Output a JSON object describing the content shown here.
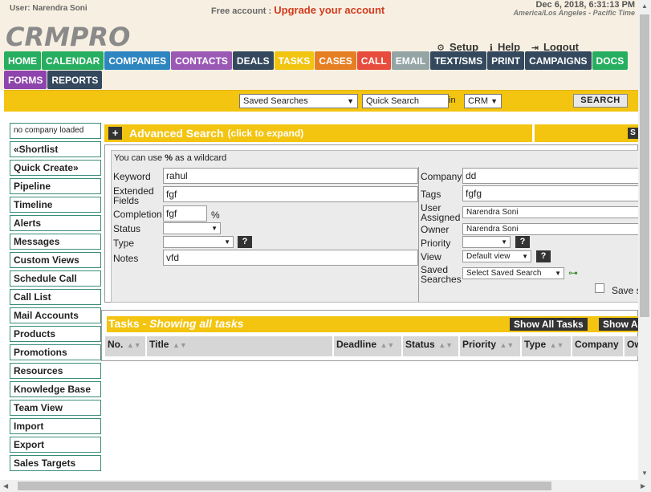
{
  "header": {
    "user": "User: Narendra Soni",
    "free_account": "Free account : ",
    "upgrade_link": "Upgrade your account",
    "datetime": "Dec 6, 2018, 6:31:13 PM",
    "timezone": "America/Los Angeles - Pacific Time",
    "logo": "CRMPRO",
    "setup": "Setup",
    "help": "Help",
    "logout": "Logout"
  },
  "nav": {
    "row1": [
      {
        "label": "HOME",
        "color": "#27ae60"
      },
      {
        "label": "CALENDAR",
        "color": "#27ae60"
      },
      {
        "label": "COMPANIES",
        "color": "#2e86c1"
      },
      {
        "label": "CONTACTS",
        "color": "#9b59b6"
      },
      {
        "label": "DEALS",
        "color": "#34495e"
      },
      {
        "label": "TASKS",
        "color": "#f1c40f"
      },
      {
        "label": "CASES",
        "color": "#e67e22"
      },
      {
        "label": "CALL",
        "color": "#e74c3c"
      },
      {
        "label": "EMAIL",
        "color": "#95a5a6"
      },
      {
        "label": "TEXT/SMS",
        "color": "#34495e"
      },
      {
        "label": "PRINT",
        "color": "#34495e"
      },
      {
        "label": "CAMPAIGNS",
        "color": "#34495e"
      },
      {
        "label": "DOCS",
        "color": "#27ae60"
      }
    ],
    "row2": [
      {
        "label": "FORMS",
        "color": "#8e44ad"
      },
      {
        "label": "REPORTS",
        "color": "#34495e"
      }
    ]
  },
  "searchbar": {
    "saved_searches": "Saved Searches",
    "quick_search": "Quick Search",
    "in_label": "in",
    "scope": "CRM",
    "search_button": "SEARCH"
  },
  "sidebar": {
    "company": "no company loaded",
    "items": [
      "«Shortlist",
      "Quick Create»",
      "Pipeline",
      "Timeline",
      "Alerts",
      "Messages",
      "Custom Views",
      "Schedule Call",
      "Call List",
      "Mail Accounts",
      "Products",
      "Promotions",
      "Resources",
      "Knowledge Base",
      "Team View",
      "Import",
      "Export",
      "Sales Targets"
    ]
  },
  "advanced": {
    "plus": "+",
    "title": "Advanced Search",
    "subtitle": "(click to expand)",
    "save_s": "S",
    "wildcard_pre": "You can use ",
    "wildcard_sym": "%",
    "wildcard_post": " as a wildcard",
    "keyword_label": "Keyword",
    "keyword_value": "rahul",
    "ext_label1": "Extended",
    "ext_label2": "Fields",
    "ext_value": "fgf",
    "completion_label": "Completion",
    "completion_value": "fgf",
    "percent": "%",
    "status_label": "Status",
    "type_label": "Type",
    "notes_label": "Notes",
    "notes_value": "vfd",
    "company_label": "Company",
    "company_value": "dd",
    "tags_label": "Tags",
    "tags_value": "fgfg",
    "user_label1": "User",
    "user_label2": "Assigned",
    "user_value": "Narendra Soni",
    "owner_label": "Owner",
    "owner_value": "Narendra Soni",
    "priority_label": "Priority",
    "view_label": "View",
    "view_value": "Default view",
    "saved_label1": "Saved",
    "saved_label2": "Searches",
    "saved_value": "Select Saved Search",
    "save_search": "Save s",
    "q": "?"
  },
  "tasks": {
    "title": "Tasks - ",
    "subtitle": "Showing all tasks",
    "show_all": "Show All Tasks",
    "show_a": "Show A",
    "columns": [
      "No.",
      "Title",
      "Deadline",
      "Status",
      "Priority",
      "Type",
      "Company",
      "Ow"
    ]
  },
  "colors": {
    "accent_yellow": "#f3c410",
    "header_bg": "#f7f0e2",
    "upgrade_red": "#d33b1f",
    "sidebar_border": "#3a8d7a"
  }
}
